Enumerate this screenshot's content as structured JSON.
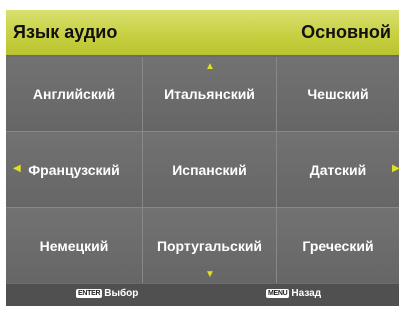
{
  "header": {
    "title": "Язык аудио",
    "current_value": "Основной"
  },
  "languages": [
    "Английский",
    "Итальянский",
    "Чешский",
    "Французский",
    "Испанский",
    "Датский",
    "Немецкий",
    "Португальский",
    "Греческий"
  ],
  "footer": {
    "enter_key": "ENTER",
    "enter_label": "Выбор",
    "menu_key": "MENU",
    "menu_label": "Назад"
  },
  "icons": {
    "up": "arrow-up-icon",
    "down": "arrow-down-icon",
    "left": "arrow-left-icon",
    "right": "arrow-right-icon"
  },
  "colors": {
    "header": "#c6cf3e",
    "arrow": "#e0e020",
    "panel": "#6b6b6b"
  }
}
